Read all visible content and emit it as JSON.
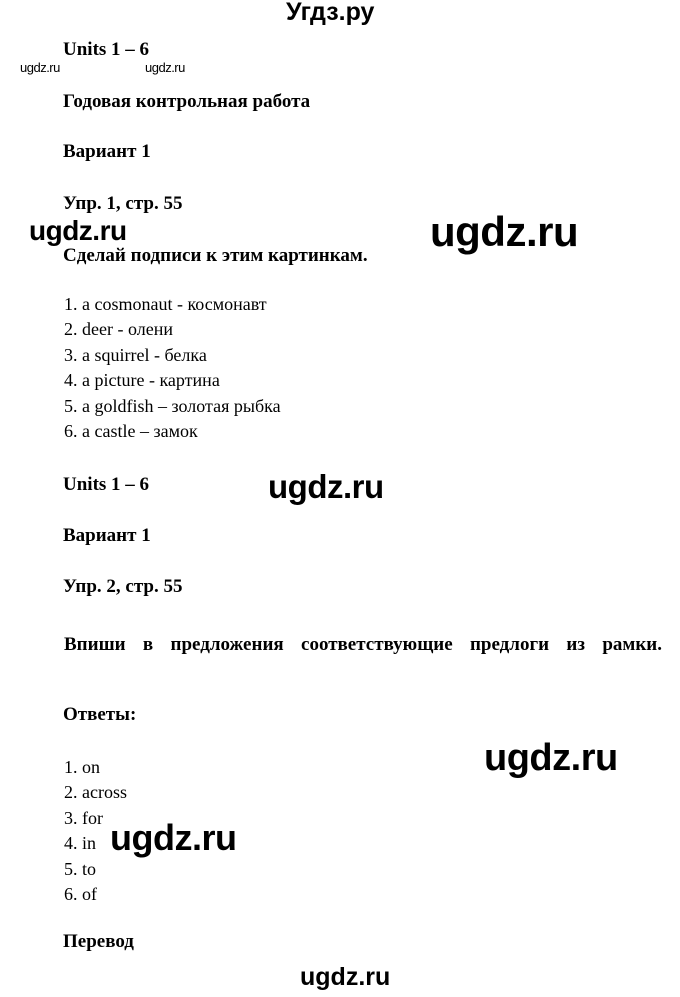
{
  "watermarks": {
    "top": "Угдз.ру",
    "small_left": "ugdz.ru",
    "small_right": "ugdz.ru",
    "mid_left": "ugdz.ru",
    "mid_right": "ugdz.ru",
    "units2": "ugdz.ru",
    "answers_right": "ugdz.ru",
    "answers_left": "ugdz.ru",
    "bottom": "ugdz.ru"
  },
  "section1": {
    "units": "Units 1 – 6",
    "annual_test": "Годовая контрольная работа",
    "variant": "Вариант 1",
    "exercise": "Упр. 1, стр. 55",
    "task": "Сделай подписи к этим картинкам.",
    "answers": [
      "1. a cosmonaut - космонавт",
      "2. deer - олени",
      "3. a squirrel - белка",
      "4. a picture - картина",
      "5. a goldfish – золотая рыбка",
      "6. a castle – замок"
    ]
  },
  "section2": {
    "units": "Units 1 – 6",
    "variant": "Вариант 1",
    "exercise": "Упр. 2, стр. 55",
    "task": "Впиши в предложения соответствующие предлоги из рамки.",
    "answers_label": "Ответы:",
    "answers": [
      "1. on",
      "2. across",
      "3. for",
      "4. in",
      "5. to",
      "6. of"
    ],
    "translation_label": "Перевод"
  }
}
